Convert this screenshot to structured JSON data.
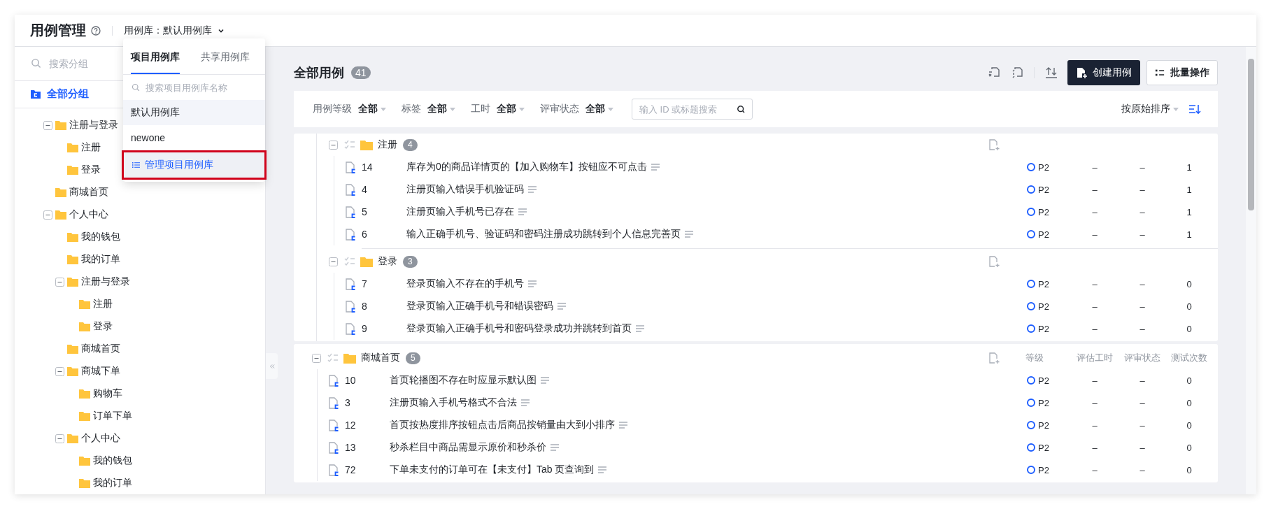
{
  "header": {
    "title": "用例管理",
    "library_label": "用例库：",
    "library_value": "默认用例库"
  },
  "library_dropdown": {
    "tabs": [
      {
        "label": "项目用例库",
        "selected": true
      },
      {
        "label": "共享用例库",
        "selected": false
      }
    ],
    "search": {
      "placeholder": "搜索项目用例库名称"
    },
    "items": [
      {
        "label": "默认用例库",
        "selected": true
      },
      {
        "label": "newone",
        "selected": false
      }
    ],
    "manage_link": "管理项目用例库"
  },
  "sidebar": {
    "search": {
      "placeholder": "搜索分组"
    },
    "all_groups": {
      "label": "全部分组",
      "selected": true
    },
    "tree": [
      {
        "label": "注册与登录",
        "selected": false,
        "expanded": true,
        "children": [
          {
            "label": "注册",
            "selected": false
          },
          {
            "label": "登录",
            "selected": false
          }
        ]
      },
      {
        "label": "商城首页",
        "selected": false
      },
      {
        "label": "个人中心",
        "selected": false,
        "expanded": true,
        "children": [
          {
            "label": "我的钱包",
            "selected": false
          },
          {
            "label": "我的订单",
            "selected": false
          },
          {
            "label": "注册与登录",
            "selected": false,
            "expanded": true,
            "children": [
              {
                "label": "注册",
                "selected": false
              },
              {
                "label": "登录",
                "selected": false
              }
            ]
          },
          {
            "label": "商城首页",
            "selected": false
          },
          {
            "label": "商城下单",
            "selected": false,
            "expanded": true,
            "children": [
              {
                "label": "购物车",
                "selected": false
              },
              {
                "label": "订单下单",
                "selected": false
              }
            ]
          },
          {
            "label": "个人中心",
            "selected": false,
            "expanded": true,
            "children": [
              {
                "label": "我的钱包",
                "selected": false
              },
              {
                "label": "我的订单",
                "selected": false
              }
            ]
          }
        ]
      }
    ]
  },
  "main": {
    "title": "全部用例",
    "count": "41",
    "create_button": "创建用例",
    "batch_button": "批量操作",
    "filters": [
      {
        "label": "用例等级",
        "value": "全部"
      },
      {
        "label": "标签",
        "value": "全部"
      },
      {
        "label": "工时",
        "value": "全部"
      },
      {
        "label": "评审状态",
        "value": "全部"
      }
    ],
    "search": {
      "placeholder": "输入 ID 或标题搜索"
    },
    "sort": "按原始排序"
  },
  "case_sections": [
    {
      "nested": true,
      "groups": [
        {
          "name": "注册",
          "count": "4",
          "expanded": true,
          "cases": [
            {
              "id": "14",
              "title": "库存为0的商品详情页的【加入购物车】按钮应不可点击",
              "priority": "P2",
              "estimate": "–",
              "review": "–",
              "runs": "1"
            },
            {
              "id": "4",
              "title": "注册页输入错误手机验证码",
              "priority": "P2",
              "estimate": "–",
              "review": "–",
              "runs": "1"
            },
            {
              "id": "5",
              "title": "注册页输入手机号已存在",
              "priority": "P2",
              "estimate": "–",
              "review": "–",
              "runs": "1"
            },
            {
              "id": "6",
              "title": "输入正确手机号、验证码和密码注册成功跳转到个人信息完善页",
              "priority": "P2",
              "estimate": "–",
              "review": "–",
              "runs": "1"
            }
          ]
        },
        {
          "name": "登录",
          "count": "3",
          "expanded": true,
          "cases": [
            {
              "id": "7",
              "title": "登录页输入不存在的手机号",
              "priority": "P2",
              "estimate": "–",
              "review": "–",
              "runs": "0"
            },
            {
              "id": "8",
              "title": "登录页输入正确手机号和错误密码",
              "priority": "P2",
              "estimate": "–",
              "review": "–",
              "runs": "0"
            },
            {
              "id": "9",
              "title": "登录页输入正确手机号和密码登录成功并跳转到首页",
              "priority": "P2",
              "estimate": "–",
              "review": "–",
              "runs": "0"
            }
          ]
        }
      ]
    },
    {
      "nested": false,
      "groups": [
        {
          "name": "商城首页",
          "count": "5",
          "expanded": true,
          "columns": [
            "等级",
            "评估工时",
            "评审状态",
            "测试次数"
          ],
          "cases": [
            {
              "id": "10",
              "title": "首页轮播图不存在时应显示默认图",
              "priority": "P2",
              "estimate": "–",
              "review": "–",
              "runs": "0"
            },
            {
              "id": "3",
              "title": "注册页输入手机号格式不合法",
              "priority": "P2",
              "estimate": "–",
              "review": "–",
              "runs": "0"
            },
            {
              "id": "12",
              "title": "首页按热度排序按钮点击后商品按销量由大到小排序",
              "priority": "P2",
              "estimate": "–",
              "review": "–",
              "runs": "0"
            },
            {
              "id": "13",
              "title": "秒杀栏目中商品需显示原价和秒杀价",
              "priority": "P2",
              "estimate": "–",
              "review": "–",
              "runs": "0"
            },
            {
              "id": "72",
              "title": "下单未支付的订单可在【未支付】Tab 页查询到",
              "priority": "P2",
              "estimate": "–",
              "review": "–",
              "runs": "0"
            }
          ]
        }
      ]
    }
  ]
}
